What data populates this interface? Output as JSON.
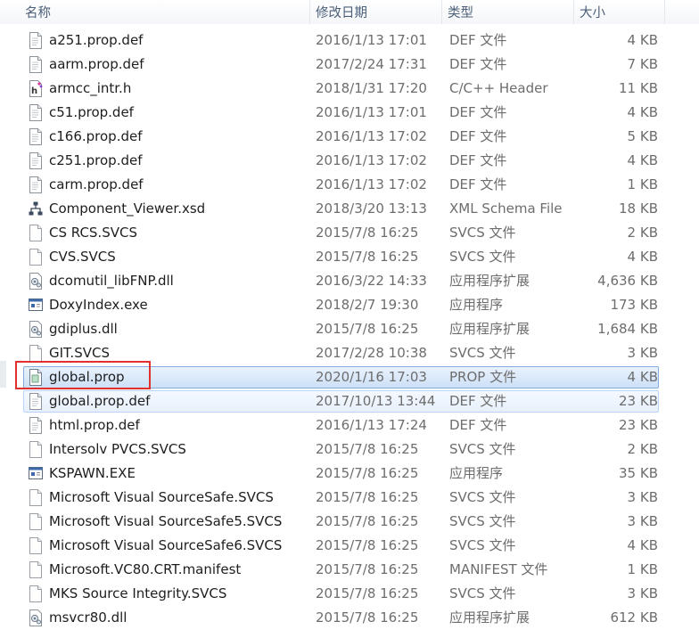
{
  "header": {
    "name": "名称",
    "date": "修改日期",
    "type": "类型",
    "size": "大小",
    "sort_indicator": "⌃"
  },
  "files": [
    {
      "name": "a251.prop.def",
      "date": "2016/1/13 17:01",
      "type": "DEF 文件",
      "size": "4 KB",
      "icon": "document-icon"
    },
    {
      "name": "aarm.prop.def",
      "date": "2017/2/24 17:31",
      "type": "DEF 文件",
      "size": "7 KB",
      "icon": "document-icon"
    },
    {
      "name": "armcc_intr.h",
      "date": "2018/1/31 17:20",
      "type": "C/C++ Header",
      "size": "11 KB",
      "icon": "header-file-icon"
    },
    {
      "name": "c51.prop.def",
      "date": "2016/1/13 17:01",
      "type": "DEF 文件",
      "size": "4 KB",
      "icon": "document-icon"
    },
    {
      "name": "c166.prop.def",
      "date": "2016/1/13 17:02",
      "type": "DEF 文件",
      "size": "5 KB",
      "icon": "document-icon"
    },
    {
      "name": "c251.prop.def",
      "date": "2016/1/13 17:02",
      "type": "DEF 文件",
      "size": "4 KB",
      "icon": "document-icon"
    },
    {
      "name": "carm.prop.def",
      "date": "2016/1/13 17:02",
      "type": "DEF 文件",
      "size": "1 KB",
      "icon": "document-icon"
    },
    {
      "name": "Component_Viewer.xsd",
      "date": "2018/3/20 13:13",
      "type": "XML Schema File",
      "size": "18 KB",
      "icon": "xml-schema-icon"
    },
    {
      "name": "CS RCS.SVCS",
      "date": "2015/7/8 16:25",
      "type": "SVCS 文件",
      "size": "2 KB",
      "icon": "blank-file-icon"
    },
    {
      "name": "CVS.SVCS",
      "date": "2015/7/8 16:25",
      "type": "SVCS 文件",
      "size": "4 KB",
      "icon": "blank-file-icon"
    },
    {
      "name": "dcomutil_libFNP.dll",
      "date": "2016/3/22 14:33",
      "type": "应用程序扩展",
      "size": "4,636 KB",
      "icon": "dll-icon"
    },
    {
      "name": "DoxyIndex.exe",
      "date": "2018/2/7 19:30",
      "type": "应用程序",
      "size": "173 KB",
      "icon": "exe-icon"
    },
    {
      "name": "gdiplus.dll",
      "date": "2015/7/8 16:25",
      "type": "应用程序扩展",
      "size": "1,684 KB",
      "icon": "dll-icon"
    },
    {
      "name": "GIT.SVCS",
      "date": "2017/2/28 10:38",
      "type": "SVCS 文件",
      "size": "3 KB",
      "icon": "blank-file-icon"
    },
    {
      "name": "global.prop",
      "date": "2020/1/16 17:03",
      "type": "PROP 文件",
      "size": "4 KB",
      "icon": "prop-file-icon",
      "state": "selected"
    },
    {
      "name": "global.prop.def",
      "date": "2017/10/13 13:44",
      "type": "DEF 文件",
      "size": "23 KB",
      "icon": "document-icon",
      "state": "hover"
    },
    {
      "name": "html.prop.def",
      "date": "2016/1/13 17:24",
      "type": "DEF 文件",
      "size": "23 KB",
      "icon": "document-icon"
    },
    {
      "name": "Intersolv PVCS.SVCS",
      "date": "2015/7/8 16:25",
      "type": "SVCS 文件",
      "size": "2 KB",
      "icon": "blank-file-icon"
    },
    {
      "name": "KSPAWN.EXE",
      "date": "2015/7/8 16:25",
      "type": "应用程序",
      "size": "35 KB",
      "icon": "exe-icon"
    },
    {
      "name": "Microsoft Visual SourceSafe.SVCS",
      "date": "2015/7/8 16:25",
      "type": "SVCS 文件",
      "size": "3 KB",
      "icon": "blank-file-icon"
    },
    {
      "name": "Microsoft Visual SourceSafe5.SVCS",
      "date": "2015/7/8 16:25",
      "type": "SVCS 文件",
      "size": "3 KB",
      "icon": "blank-file-icon"
    },
    {
      "name": "Microsoft Visual SourceSafe6.SVCS",
      "date": "2015/7/8 16:25",
      "type": "SVCS 文件",
      "size": "4 KB",
      "icon": "blank-file-icon"
    },
    {
      "name": "Microsoft.VC80.CRT.manifest",
      "date": "2015/7/8 16:25",
      "type": "MANIFEST 文件",
      "size": "1 KB",
      "icon": "blank-file-icon"
    },
    {
      "name": "MKS Source Integrity.SVCS",
      "date": "2015/7/8 16:25",
      "type": "SVCS 文件",
      "size": "3 KB",
      "icon": "blank-file-icon"
    },
    {
      "name": "msvcr80.dll",
      "date": "2015/7/8 16:25",
      "type": "应用程序扩展",
      "size": "612 KB",
      "icon": "dll-icon"
    }
  ],
  "colors": {
    "accent_selection": "#cde0f7",
    "focus_box": "#e03030",
    "header_text": "#4c607a"
  }
}
